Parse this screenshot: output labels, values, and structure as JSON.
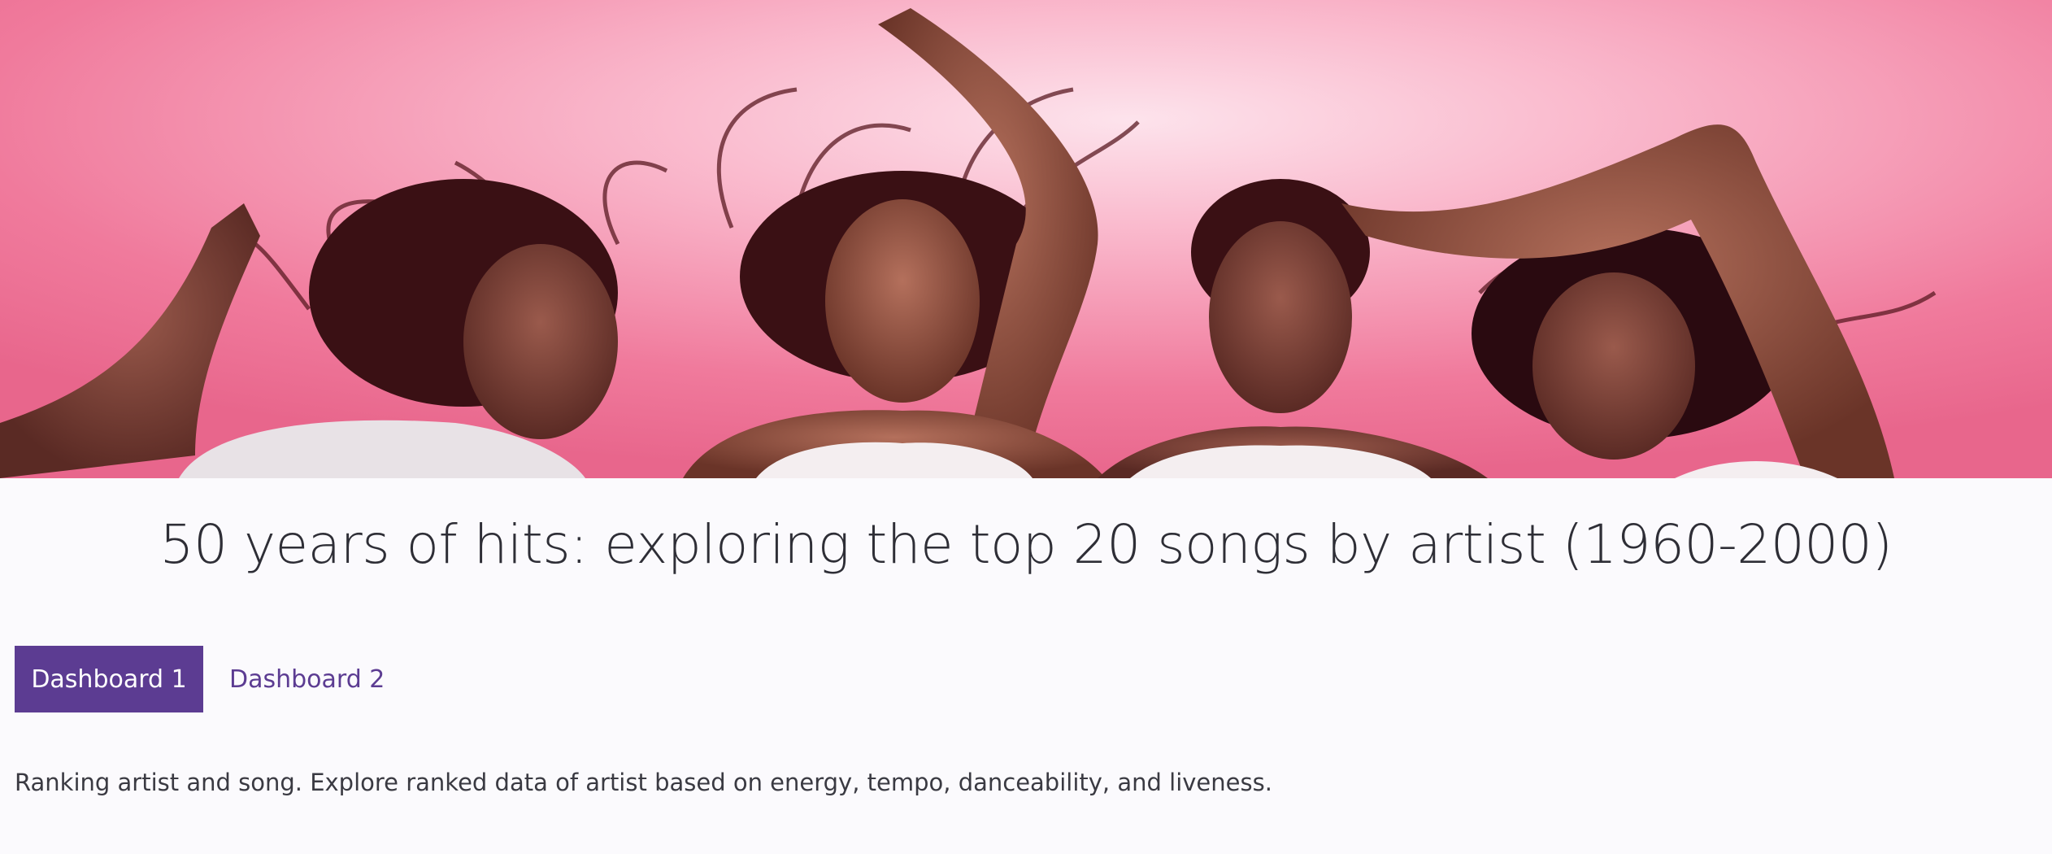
{
  "header": {
    "banner_image": "four-women-lying-on-pink-background-photo"
  },
  "page": {
    "title": "50 years of hits: exploring the top 20 songs by artist (1960-2000)",
    "description": "Ranking artist and song. Explore ranked data of artist based on energy, tempo, danceability, and liveness."
  },
  "tabs": [
    {
      "label": "Dashboard 1",
      "active": true
    },
    {
      "label": "Dashboard 2",
      "active": false
    }
  ],
  "colors": {
    "accent": "#5c3c92",
    "background": "#fbfafd",
    "banner_pink": "#f07a9c",
    "text": "#2e2e36"
  }
}
